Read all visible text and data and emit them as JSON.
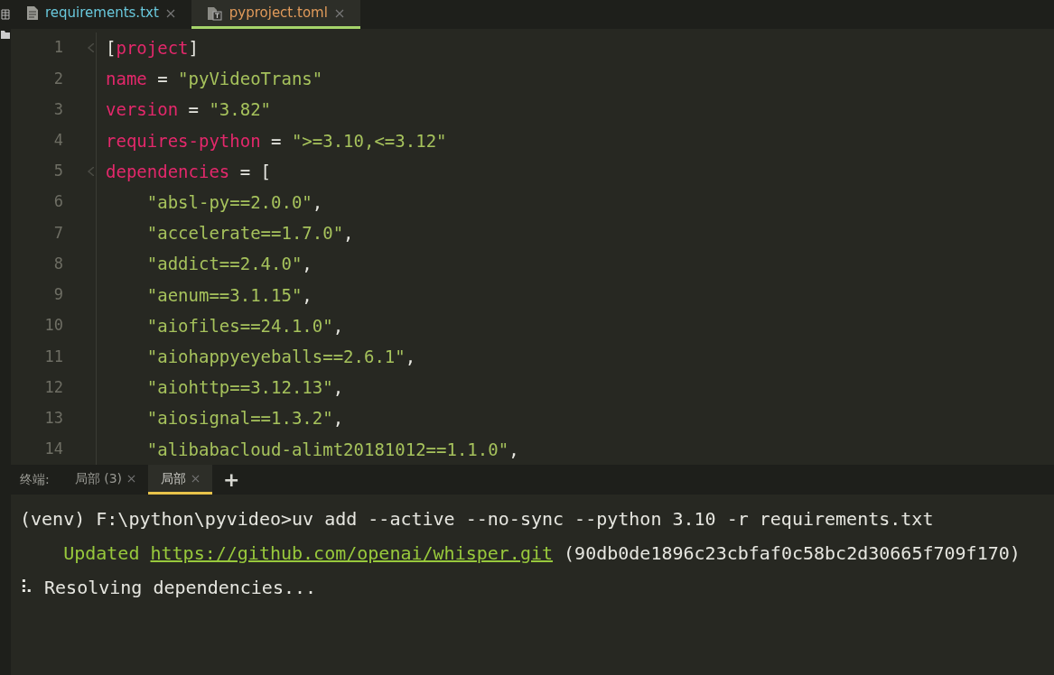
{
  "editor_tabs": [
    {
      "label": "requirements.txt",
      "selected": false,
      "kind": "text"
    },
    {
      "label": "pyproject.toml",
      "selected": true,
      "kind": "toml"
    }
  ],
  "code_lines": [
    {
      "number": "1",
      "foldable": true,
      "tokens": [
        {
          "kind": "punct",
          "text": "["
        },
        {
          "kind": "key",
          "text": "project"
        },
        {
          "kind": "punct",
          "text": "]"
        }
      ]
    },
    {
      "number": "2",
      "foldable": false,
      "tokens": [
        {
          "kind": "key",
          "text": "name"
        },
        {
          "kind": "punct",
          "text": " = "
        },
        {
          "kind": "string",
          "text": "\"pyVideoTrans\""
        }
      ]
    },
    {
      "number": "3",
      "foldable": false,
      "tokens": [
        {
          "kind": "key",
          "text": "version"
        },
        {
          "kind": "punct",
          "text": " = "
        },
        {
          "kind": "string",
          "text": "\"3.82\""
        }
      ]
    },
    {
      "number": "4",
      "foldable": false,
      "tokens": [
        {
          "kind": "key",
          "text": "requires-python"
        },
        {
          "kind": "punct",
          "text": " = "
        },
        {
          "kind": "string",
          "text": "\">=3.10,<=3.12\""
        }
      ]
    },
    {
      "number": "5",
      "foldable": true,
      "tokens": [
        {
          "kind": "key",
          "text": "dependencies"
        },
        {
          "kind": "punct",
          "text": " = ["
        }
      ]
    },
    {
      "number": "6",
      "foldable": false,
      "tokens": [
        {
          "kind": "string",
          "text": "    \"absl-py==2.0.0\""
        },
        {
          "kind": "punct",
          "text": ","
        }
      ]
    },
    {
      "number": "7",
      "foldable": false,
      "tokens": [
        {
          "kind": "string",
          "text": "    \"accelerate==1.7.0\""
        },
        {
          "kind": "punct",
          "text": ","
        }
      ]
    },
    {
      "number": "8",
      "foldable": false,
      "tokens": [
        {
          "kind": "string",
          "text": "    \"addict==2.4.0\""
        },
        {
          "kind": "punct",
          "text": ","
        }
      ]
    },
    {
      "number": "9",
      "foldable": false,
      "tokens": [
        {
          "kind": "string",
          "text": "    \"aenum==3.1.15\""
        },
        {
          "kind": "punct",
          "text": ","
        }
      ]
    },
    {
      "number": "10",
      "foldable": false,
      "tokens": [
        {
          "kind": "string",
          "text": "    \"aiofiles==24.1.0\""
        },
        {
          "kind": "punct",
          "text": ","
        }
      ]
    },
    {
      "number": "11",
      "foldable": false,
      "tokens": [
        {
          "kind": "string",
          "text": "    \"aiohappyeyeballs==2.6.1\""
        },
        {
          "kind": "punct",
          "text": ","
        }
      ]
    },
    {
      "number": "12",
      "foldable": false,
      "tokens": [
        {
          "kind": "string",
          "text": "    \"aiohttp==3.12.13\""
        },
        {
          "kind": "punct",
          "text": ","
        }
      ]
    },
    {
      "number": "13",
      "foldable": false,
      "tokens": [
        {
          "kind": "string",
          "text": "    \"aiosignal==1.3.2\""
        },
        {
          "kind": "punct",
          "text": ","
        }
      ]
    },
    {
      "number": "14",
      "foldable": false,
      "tokens": [
        {
          "kind": "string",
          "text": "    \"alibabacloud-alimt20181012==1.1.0\""
        },
        {
          "kind": "punct",
          "text": ","
        }
      ]
    }
  ],
  "terminal": {
    "label": "终端:",
    "tabs": [
      {
        "label": "局部 (3)",
        "selected": false
      },
      {
        "label": "局部",
        "selected": true
      }
    ],
    "add_button": "+",
    "lines": [
      {
        "segments": [
          {
            "kind": "plain",
            "text": "(venv) F:\\python\\pyvideo>uv add --active --no-sync --python 3.10 -r requirements.txt"
          }
        ]
      },
      {
        "segments": [
          {
            "kind": "green",
            "text": "    Updated "
          },
          {
            "kind": "link",
            "text": "https://github.com/openai/whisper.git"
          },
          {
            "kind": "plain",
            "text": " (90db0de1896c23cbfaf0c58bc2d30665f709f170)"
          }
        ]
      },
      {
        "segments": [
          {
            "kind": "plain",
            "text": "⠧ Resolving dependencies..."
          }
        ]
      }
    ]
  }
}
